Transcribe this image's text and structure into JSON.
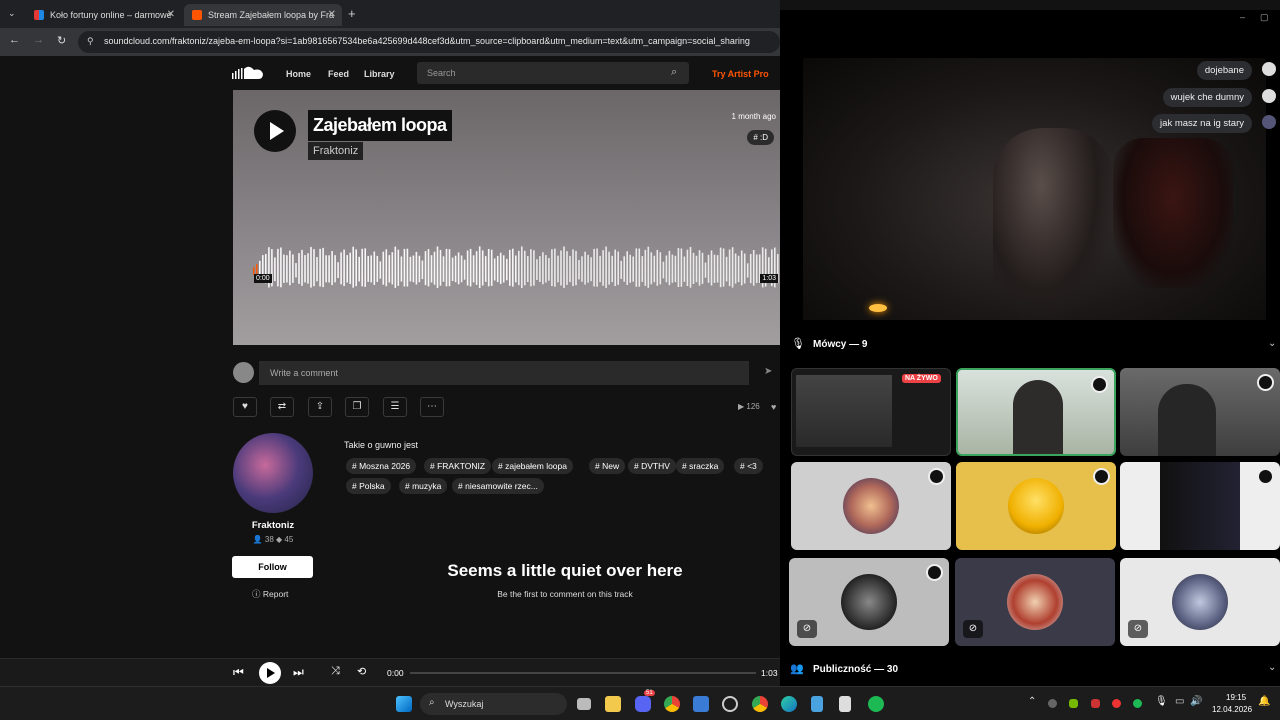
{
  "browser": {
    "tabs": [
      {
        "label": "Koło fortuny online – darmowe",
        "active": false
      },
      {
        "label": "Stream Zajebałem loopa by Fra",
        "active": true
      }
    ],
    "url": "soundcloud.com/fraktoniz/zajeba-em-loopa?si=1ab9816567534be6a425699d448cef3d&utm_source=clipboard&utm_medium=text&utm_campaign=social_sharing"
  },
  "soundcloud": {
    "nav": {
      "home": "Home",
      "feed": "Feed",
      "library": "Library",
      "search_placeholder": "Search",
      "try_pro": "Try Artist Pro"
    },
    "track": {
      "title": "Zajebałem loopa",
      "artist": "Fraktoniz",
      "posted": "1 month ago",
      "genre_tag": "# :D",
      "time_start": "0:00",
      "time_end": "1:03",
      "played_fraction": 0.01
    },
    "comment_placeholder": "Write a comment",
    "plays": "126",
    "description": "Takie o guwno jest",
    "tags": [
      "Moszna 2026",
      "FRAKTONIZ",
      "zajebałem loopa",
      "New",
      "DVTHV",
      "sraczka",
      "<3",
      "Polska",
      "muzyka",
      "niesamowite rzec..."
    ],
    "profile": {
      "name": "Fraktoniz",
      "followers": "38",
      "tracks": "45",
      "follow_label": "Follow",
      "report_label": "Report"
    },
    "empty": {
      "title": "Seems a little quiet over here",
      "subtitle": "Be the first to comment on this track"
    },
    "player": {
      "elapsed": "0:00",
      "duration": "1:03"
    }
  },
  "discord": {
    "chat": [
      "dojebane",
      "wujek che dumny",
      "jak masz na ig stary"
    ],
    "speakers_label": "Mówcy — 9",
    "audience_label": "Publiczność — 30",
    "live_badge": "NA ŻYWO"
  },
  "taskbar": {
    "search_placeholder": "Wyszukaj",
    "discord_badge": "51",
    "time": "19:15",
    "date": "12.04.2026"
  },
  "colors": {
    "accent": "#ff5500",
    "discord_blurple": "#5865f2",
    "spotify": "#1db954"
  }
}
